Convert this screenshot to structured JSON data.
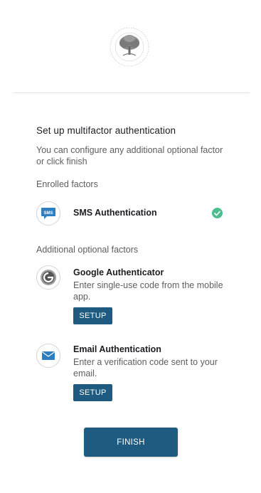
{
  "header": {
    "logo_icon": "tree-seal-logo-icon"
  },
  "page": {
    "title": "Set up multifactor authentication",
    "subtitle": "You can configure any additional optional factor or click finish"
  },
  "enrolled": {
    "label": "Enrolled factors",
    "factors": [
      {
        "name": "SMS Authentication",
        "icon": "sms-icon",
        "status_icon": "check-circle-icon",
        "status_color": "#4cbf8f"
      }
    ]
  },
  "optional": {
    "label": "Additional optional factors",
    "factors": [
      {
        "name": "Google Authenticator",
        "description": "Enter single-use code from the mobile app.",
        "button_label": "SETUP",
        "icon": "google-authenticator-icon"
      },
      {
        "name": "Email Authentication",
        "description": "Enter a verification code sent to your email.",
        "button_label": "SETUP",
        "icon": "email-icon"
      }
    ]
  },
  "actions": {
    "finish_label": "FINISH"
  },
  "colors": {
    "primary_button": "#1f5a80",
    "success": "#4cbf8f",
    "divider": "#e3e3e3"
  }
}
